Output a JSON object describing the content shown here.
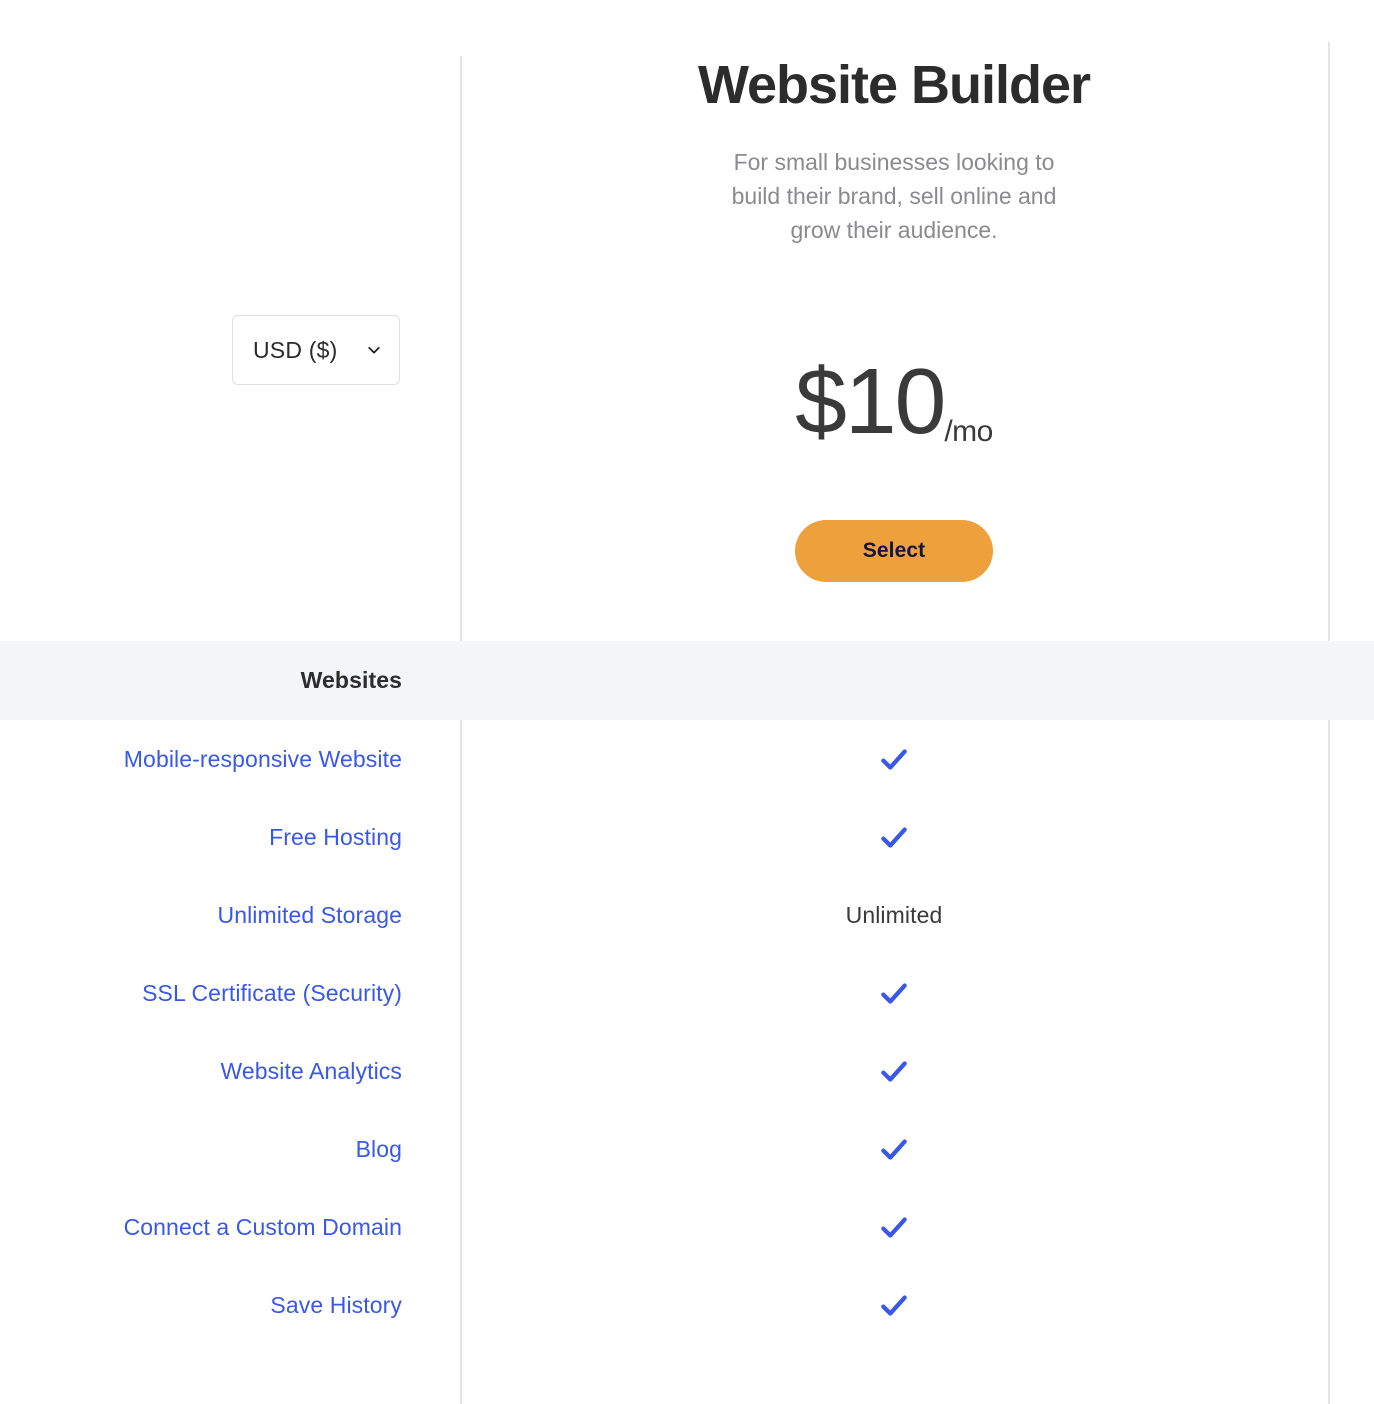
{
  "currency": {
    "selected": "USD ($)",
    "chevron_icon": "chevron-down-icon"
  },
  "plan": {
    "title": "Website Builder",
    "description": "For small businesses looking to build their brand, sell online and grow their audience.",
    "price_amount": "$10",
    "price_period": "/mo",
    "select_label": "Select"
  },
  "colors": {
    "link_blue": "#3a58e8",
    "check_blue": "#3a58e8",
    "button_orange": "#eda03c",
    "button_text": "#14143c",
    "band_background": "#f4f5f9",
    "divider": "#e3e3e8"
  },
  "section": {
    "title": "Websites"
  },
  "features": [
    {
      "name": "Mobile-responsive Website",
      "value": "check",
      "value_text": ""
    },
    {
      "name": "Free Hosting",
      "value": "check",
      "value_text": ""
    },
    {
      "name": "Unlimited Storage",
      "value": "text",
      "value_text": "Unlimited"
    },
    {
      "name": "SSL Certificate (Security)",
      "value": "check",
      "value_text": ""
    },
    {
      "name": "Website Analytics",
      "value": "check",
      "value_text": ""
    },
    {
      "name": "Blog",
      "value": "check",
      "value_text": ""
    },
    {
      "name": "Connect a Custom Domain",
      "value": "check",
      "value_text": ""
    },
    {
      "name": "Save History",
      "value": "check",
      "value_text": ""
    }
  ]
}
